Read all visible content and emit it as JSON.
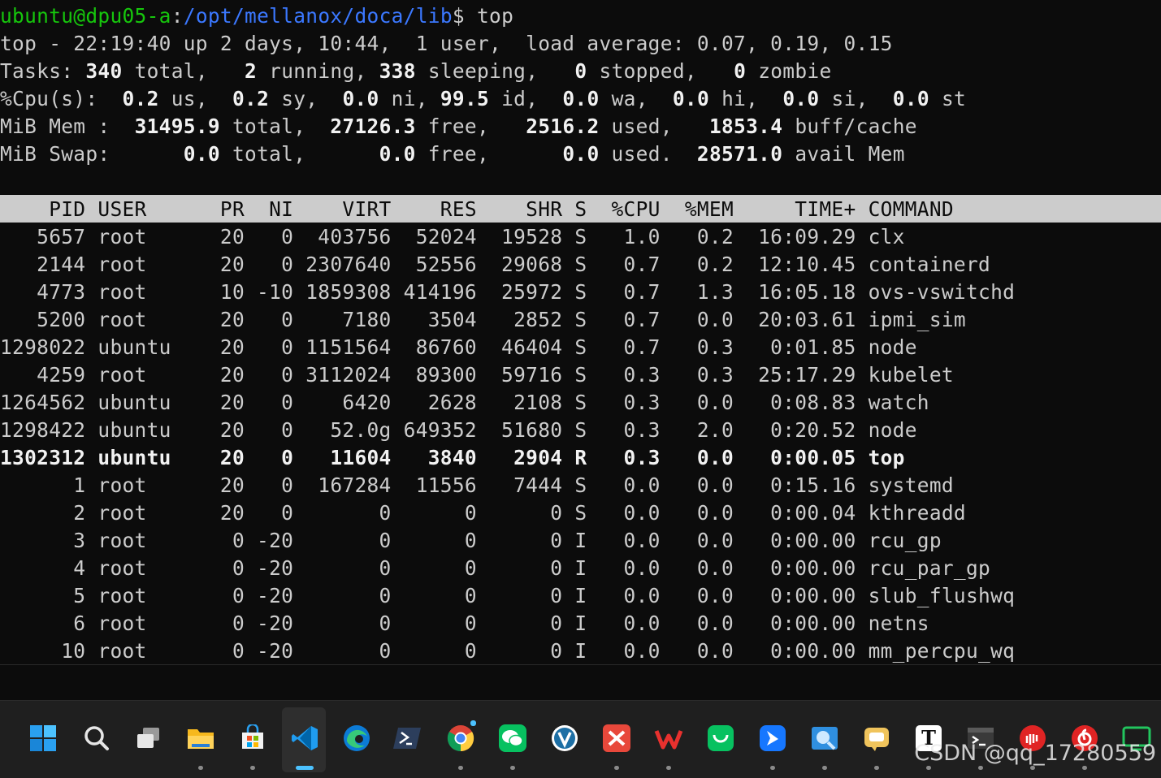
{
  "prompt": {
    "user_host": "ubuntu@dpu05-a",
    "colon": ":",
    "path": "/opt/mellanox/doca/lib",
    "dollar": "$",
    "command": " top"
  },
  "summary": {
    "uptime": "top - 22:19:40 up 2 days, 10:44,  1 user,  load average: 0.07, 0.19, 0.15",
    "tasks": {
      "a": "Tasks: ",
      "total": "340",
      "b": " total,   ",
      "running": "2",
      "c": " running, ",
      "sleeping": "338",
      "d": " sleeping,   ",
      "stopped": "0",
      "e": " stopped,   ",
      "zombie": "0",
      "f": " zombie"
    },
    "cpu": {
      "a": "%Cpu(s):  ",
      "us": "0.2",
      "b": " us,  ",
      "sy": "0.2",
      "c": " sy,  ",
      "ni": "0.0",
      "d": " ni, ",
      "id": "99.5",
      "e": " id,  ",
      "wa": "0.0",
      "f": " wa,  ",
      "hi": "0.0",
      "g": " hi,  ",
      "si": "0.0",
      "h": " si,  ",
      "st": "0.0",
      "i": " st"
    },
    "mem": {
      "a": "MiB Mem :  ",
      "total": "31495.9",
      "b": " total,  ",
      "free": "27126.3",
      "c": " free,   ",
      "used": "2516.2",
      "d": " used,   ",
      "buff": "1853.4",
      "e": " buff/cache"
    },
    "swap": {
      "a": "MiB Swap:      ",
      "total": "0.0",
      "b": " total,      ",
      "free": "0.0",
      "c": " free,      ",
      "used": "0.0",
      "d": " used.  ",
      "avail": "28571.0",
      "e": " avail Mem"
    }
  },
  "table": {
    "header": "    PID USER      PR  NI    VIRT    RES    SHR S  %CPU  %MEM     TIME+ COMMAND",
    "rows": [
      "   5657 root      20   0  403756  52024  19528 S   1.0   0.2  16:09.29 clx",
      "   2144 root      20   0 2307640  52556  29068 S   0.7   0.2  12:10.45 containerd",
      "   4773 root      10 -10 1859308 414196  25972 S   0.7   1.3  16:05.18 ovs-vswitchd",
      "   5200 root      20   0    7180   3504   2852 S   0.7   0.0  20:03.61 ipmi_sim",
      "1298022 ubuntu    20   0 1151564  86760  46404 S   0.7   0.3   0:01.85 node",
      "   4259 root      20   0 3112024  89300  59716 S   0.3   0.3  25:17.29 kubelet",
      "1264562 ubuntu    20   0    6420   2628   2108 S   0.3   0.0   0:08.83 watch",
      "1298422 ubuntu    20   0   52.0g 649352  51680 S   0.3   2.0   0:20.52 node",
      "1302312 ubuntu    20   0   11604   3840   2904 R   0.3   0.0   0:00.05 top",
      "      1 root      20   0  167284  11556   7444 S   0.0   0.0   0:15.16 systemd",
      "      2 root      20   0       0      0      0 S   0.0   0.0   0:00.04 kthreadd",
      "      3 root       0 -20       0      0      0 I   0.0   0.0   0:00.00 rcu_gp",
      "      4 root       0 -20       0      0      0 I   0.0   0.0   0:00.00 rcu_par_gp",
      "      5 root       0 -20       0      0      0 I   0.0   0.0   0:00.00 slub_flushwq",
      "      6 root       0 -20       0      0      0 I   0.0   0.0   0:00.00 netns",
      "     10 root       0 -20       0      0      0 I   0.0   0.0   0:00.00 mm_percpu_wq"
    ]
  },
  "taskbar": {
    "icons": [
      "windows-start",
      "search",
      "task-view",
      "file-explorer",
      "microsoft-store",
      "vscode",
      "edge",
      "terminal",
      "chrome",
      "wechat",
      "vnc-viewer",
      "xmind",
      "wps",
      "app-green",
      "feishu",
      "app-search",
      "app-chat",
      "typora",
      "windows-terminal",
      "netease-music-1",
      "netease-music-2",
      "app-green-2"
    ],
    "typora_glyph": "T"
  },
  "watermark": "CSDN @qq_17280559",
  "colors": {
    "prompt_green": "#16c60c",
    "prompt_blue": "#3b78ff",
    "header_bar": "#cccccc",
    "background": "#0c0c0c",
    "vscode_active": "#4cc2ff"
  }
}
